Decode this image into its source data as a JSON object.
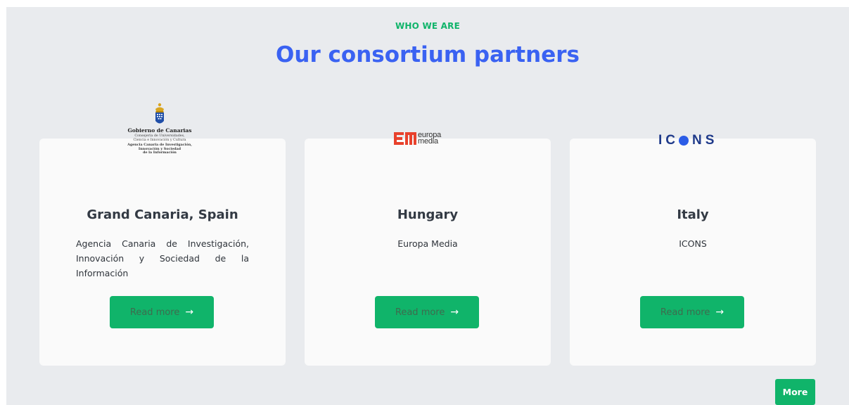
{
  "section": {
    "eyebrow": "WHO WE ARE",
    "heading": "Our consortium partners"
  },
  "partners": [
    {
      "title": "Grand Canaria, Spain",
      "description": "Agencia Canaria de Investigación, Innovación y Sociedad de la Información",
      "button_label": "Read more",
      "logo": {
        "name": "Gobierno de Canarias",
        "line1": "Consejería de Universidades,",
        "line2": "Ciencia e Innovación y Cultura",
        "agency1": "Agencia Canaria de Investigación,",
        "agency2": "Innovación y Sociedad",
        "agency3": "de la Información"
      }
    },
    {
      "title": "Hungary",
      "description": "Europa Media",
      "button_label": "Read more",
      "logo": {
        "line1": "europa",
        "line2": "media"
      }
    },
    {
      "title": "Italy",
      "description": "ICONS",
      "button_label": "Read more",
      "logo": {
        "text_before": "IC",
        "text_after": "NS"
      }
    }
  ],
  "icons": {
    "arrow": "→"
  },
  "more_label": "More",
  "colors": {
    "accent_green": "#10b46a",
    "heading_blue": "#3a62f2",
    "section_bg": "#e9ebee",
    "europa_media_red": "#e8412c",
    "icons_blue": "#1f3a8a"
  }
}
